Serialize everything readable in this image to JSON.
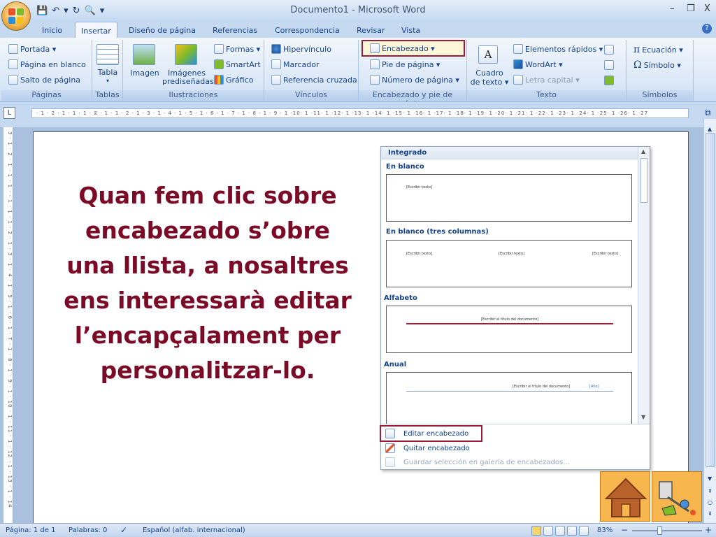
{
  "window": {
    "title": "Documento1 - Microsoft Word",
    "minimize": "–",
    "restore": "❐",
    "close": "X"
  },
  "quick_access": {
    "save": "💾",
    "undo": "↶",
    "undo_arrow": "▾",
    "redo": "↻",
    "print_preview": "🔍",
    "customize": "▾"
  },
  "tabs": [
    {
      "label": "Inicio"
    },
    {
      "label": "Insertar",
      "active": true
    },
    {
      "label": "Diseño de página"
    },
    {
      "label": "Referencias"
    },
    {
      "label": "Correspondencia"
    },
    {
      "label": "Revisar"
    },
    {
      "label": "Vista"
    }
  ],
  "ribbon": {
    "paginas": {
      "label": "Páginas",
      "portada": "Portada ▾",
      "pagina_blanco": "Página en blanco",
      "salto": "Salto de página"
    },
    "tablas": {
      "label": "Tablas",
      "tabla": "Tabla",
      "tabla_arrow": "▾"
    },
    "ilustraciones": {
      "label": "Ilustraciones",
      "imagen": "Imagen",
      "imagenes": "Imágenes",
      "prediseñadas": "prediseñadas",
      "formas": "Formas ▾",
      "smartart": "SmartArt",
      "grafico": "Gráfico"
    },
    "vinculos": {
      "label": "Vínculos",
      "hipervinculo": "Hipervínculo",
      "marcador": "Marcador",
      "referencia": "Referencia cruzada"
    },
    "encabezado_grp": {
      "label": "Encabezado y pie de página",
      "encabezado": "Encabezado ▾",
      "pie": "Pie de página ▾",
      "numero": "Número de página ▾"
    },
    "texto": {
      "label": "Texto",
      "cuadro1": "Cuadro",
      "cuadro2": "de texto ▾",
      "elementos": "Elementos rápidos ▾",
      "wordart": "WordArt ▾",
      "letra": "Letra capital ▾"
    },
    "simbolos": {
      "label": "Símbolos",
      "ecuacion": "Ecuación ▾",
      "simbolo": "Símbolo ▾"
    }
  },
  "ruler": {
    "horizontal": "· 1 · 2 · 1 · 1 · 1 · ⧖ · 1 · 1 · 2 · 1 · 3 · 1 · 4 · 1 · 5 · 1 · 6 · 1 · 7 · 1 · 8 · 1 · 9 · 1 ·10· 1 ·11· 1 ·12· 1 ·13· 1 ·14· 1 ·15· 1 ·16· 1 ·17· 1 ·18· 1 ·19· 1 ·20· 1 ·21· 1 ·22· 1 ·23· 1 ·24· 1 ·25· 1 ·26· 1 ·27",
    "vertical": "3 · 1 · 2 · 1 · 1 · 1 · · 1 · 1 · 1 · 2 · 1 · 3 · 1 · 4 · 1 · 5 · 1 · 6 · 1 · 7 · 1 · 8 · 1 · 9 · 1 · 10 · 1 · 11 · 1 · 12 · 1 · 13 · 1 · 14",
    "corner": "L"
  },
  "main_text": "Quan fem clic sobre encabezado s’obre una llista, a nosaltres ens interessarà editar l’encapçalament per personalitzar-lo.",
  "gallery": {
    "header": "Integrado",
    "sections": [
      {
        "title": "En blanco",
        "placeholders": [
          "[Escribir texto]"
        ]
      },
      {
        "title": "En blanco (tres columnas)",
        "placeholders": [
          "[Escribir texto]",
          "[Escribir texto]",
          "[Escribir texto]"
        ]
      },
      {
        "title": "Alfabeto",
        "placeholders": [
          "[Escribir el título del documento]"
        ]
      },
      {
        "title": "Anual",
        "placeholders": [
          "[Escribir el título del documento]",
          "[Año]"
        ]
      }
    ],
    "menu": {
      "editar": "Editar encabezado",
      "quitar": "Quitar encabezado",
      "guardar": "Guardar selección en galería de encabezados..."
    }
  },
  "statusbar": {
    "pagina": "Página: 1 de 1",
    "palabras": "Palabras: 0",
    "idioma": "Español (alfab. internacional)",
    "zoom": "83%",
    "zoom_minus": "−",
    "zoom_plus": "+"
  },
  "colors": {
    "accent": "#7b0a26",
    "ribbon": "#dbe8f7",
    "highlight": "#9b1b3a",
    "nav": "#f7b64e"
  }
}
